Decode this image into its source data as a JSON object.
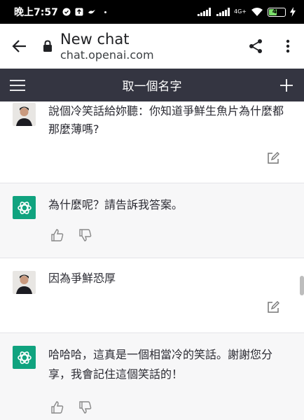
{
  "status": {
    "time": "晚上7:57",
    "network": "4G+",
    "battery": "46",
    "battery_level_percent": 46
  },
  "browser": {
    "page_title": "New chat",
    "url": "chat.openai.com"
  },
  "chat_header": {
    "title": "取一個名字"
  },
  "messages": [
    {
      "role": "user",
      "text": "說個冷笑話給妳聽：你知道爭鮮生魚片為什麼都那麼薄嗎?"
    },
    {
      "role": "assistant",
      "text": "為什麼呢？請告訴我答案。"
    },
    {
      "role": "user",
      "text": "因為爭鮮恐厚"
    },
    {
      "role": "assistant",
      "text": "哈哈哈，這真是一個相當冷的笑話。謝謝您分享，我會記住這個笑話的！"
    }
  ],
  "icons": {
    "back": "arrow-left-icon",
    "share": "share-icon",
    "more": "more-vertical-icon",
    "menu": "hamburger-menu-icon",
    "new_chat": "plus-icon",
    "edit": "edit-icon",
    "like": "thumbs-up-icon",
    "dislike": "thumbs-down-icon"
  },
  "colors": {
    "chat_header_bg": "#343541",
    "assistant_bg": "#f7f7f8",
    "gpt_green": "#10a37f"
  }
}
